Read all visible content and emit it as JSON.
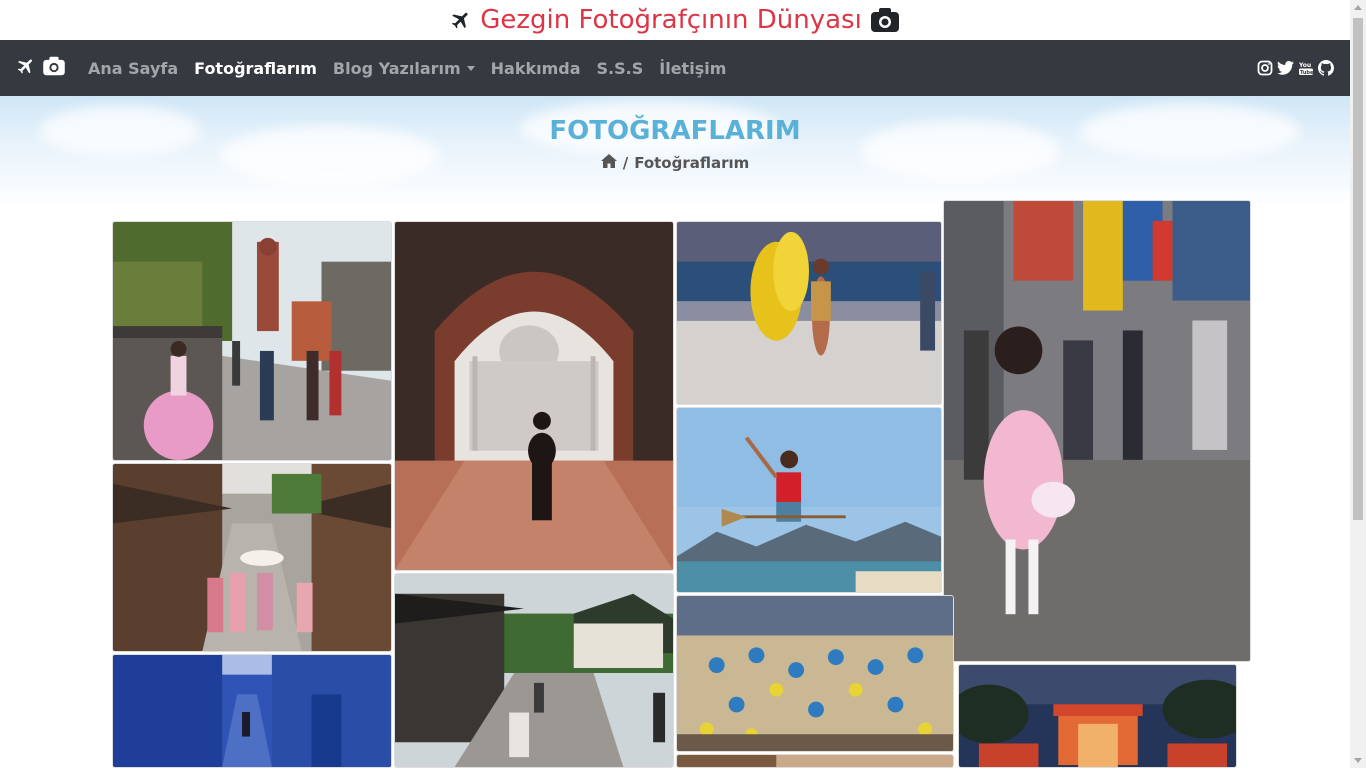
{
  "site": {
    "title": "Gezgin Fotoğrafçının Dünyası",
    "title_color": "#dc3545"
  },
  "nav": {
    "items": [
      {
        "label": "Ana Sayfa",
        "active": false
      },
      {
        "label": "Fotoğraflarım",
        "active": true
      },
      {
        "label": "Blog Yazılarım",
        "active": false,
        "dropdown": true
      },
      {
        "label": "Hakkımda",
        "active": false
      },
      {
        "label": "S.S.S",
        "active": false
      },
      {
        "label": "İletişim",
        "active": false
      }
    ],
    "social_icons": [
      "instagram-icon",
      "twitter-icon",
      "youtube-icon",
      "github-icon"
    ],
    "brand_icons": [
      "plane-icon",
      "camera-icon"
    ],
    "background": "#343a40"
  },
  "page": {
    "title": "FOTOĞRAFLARIM",
    "breadcrumb_home_icon": "home-icon",
    "breadcrumb_separator": "/",
    "breadcrumb_current": "Fotoğraflarım"
  },
  "gallery": {
    "photos": [
      "korea-hanbok-street-photo",
      "taj-mahal-arch-photo",
      "samba-carnival-dancer-photo",
      "tokyo-street-girl-photo",
      "kyoto-old-street-photo",
      "beach-broom-jump-photo",
      "kyoto-temple-photo",
      "carnival-parade-crowd-photo",
      "chefchaouen-blue-alley-photo",
      "kyoto-shrine-night-photo"
    ]
  }
}
